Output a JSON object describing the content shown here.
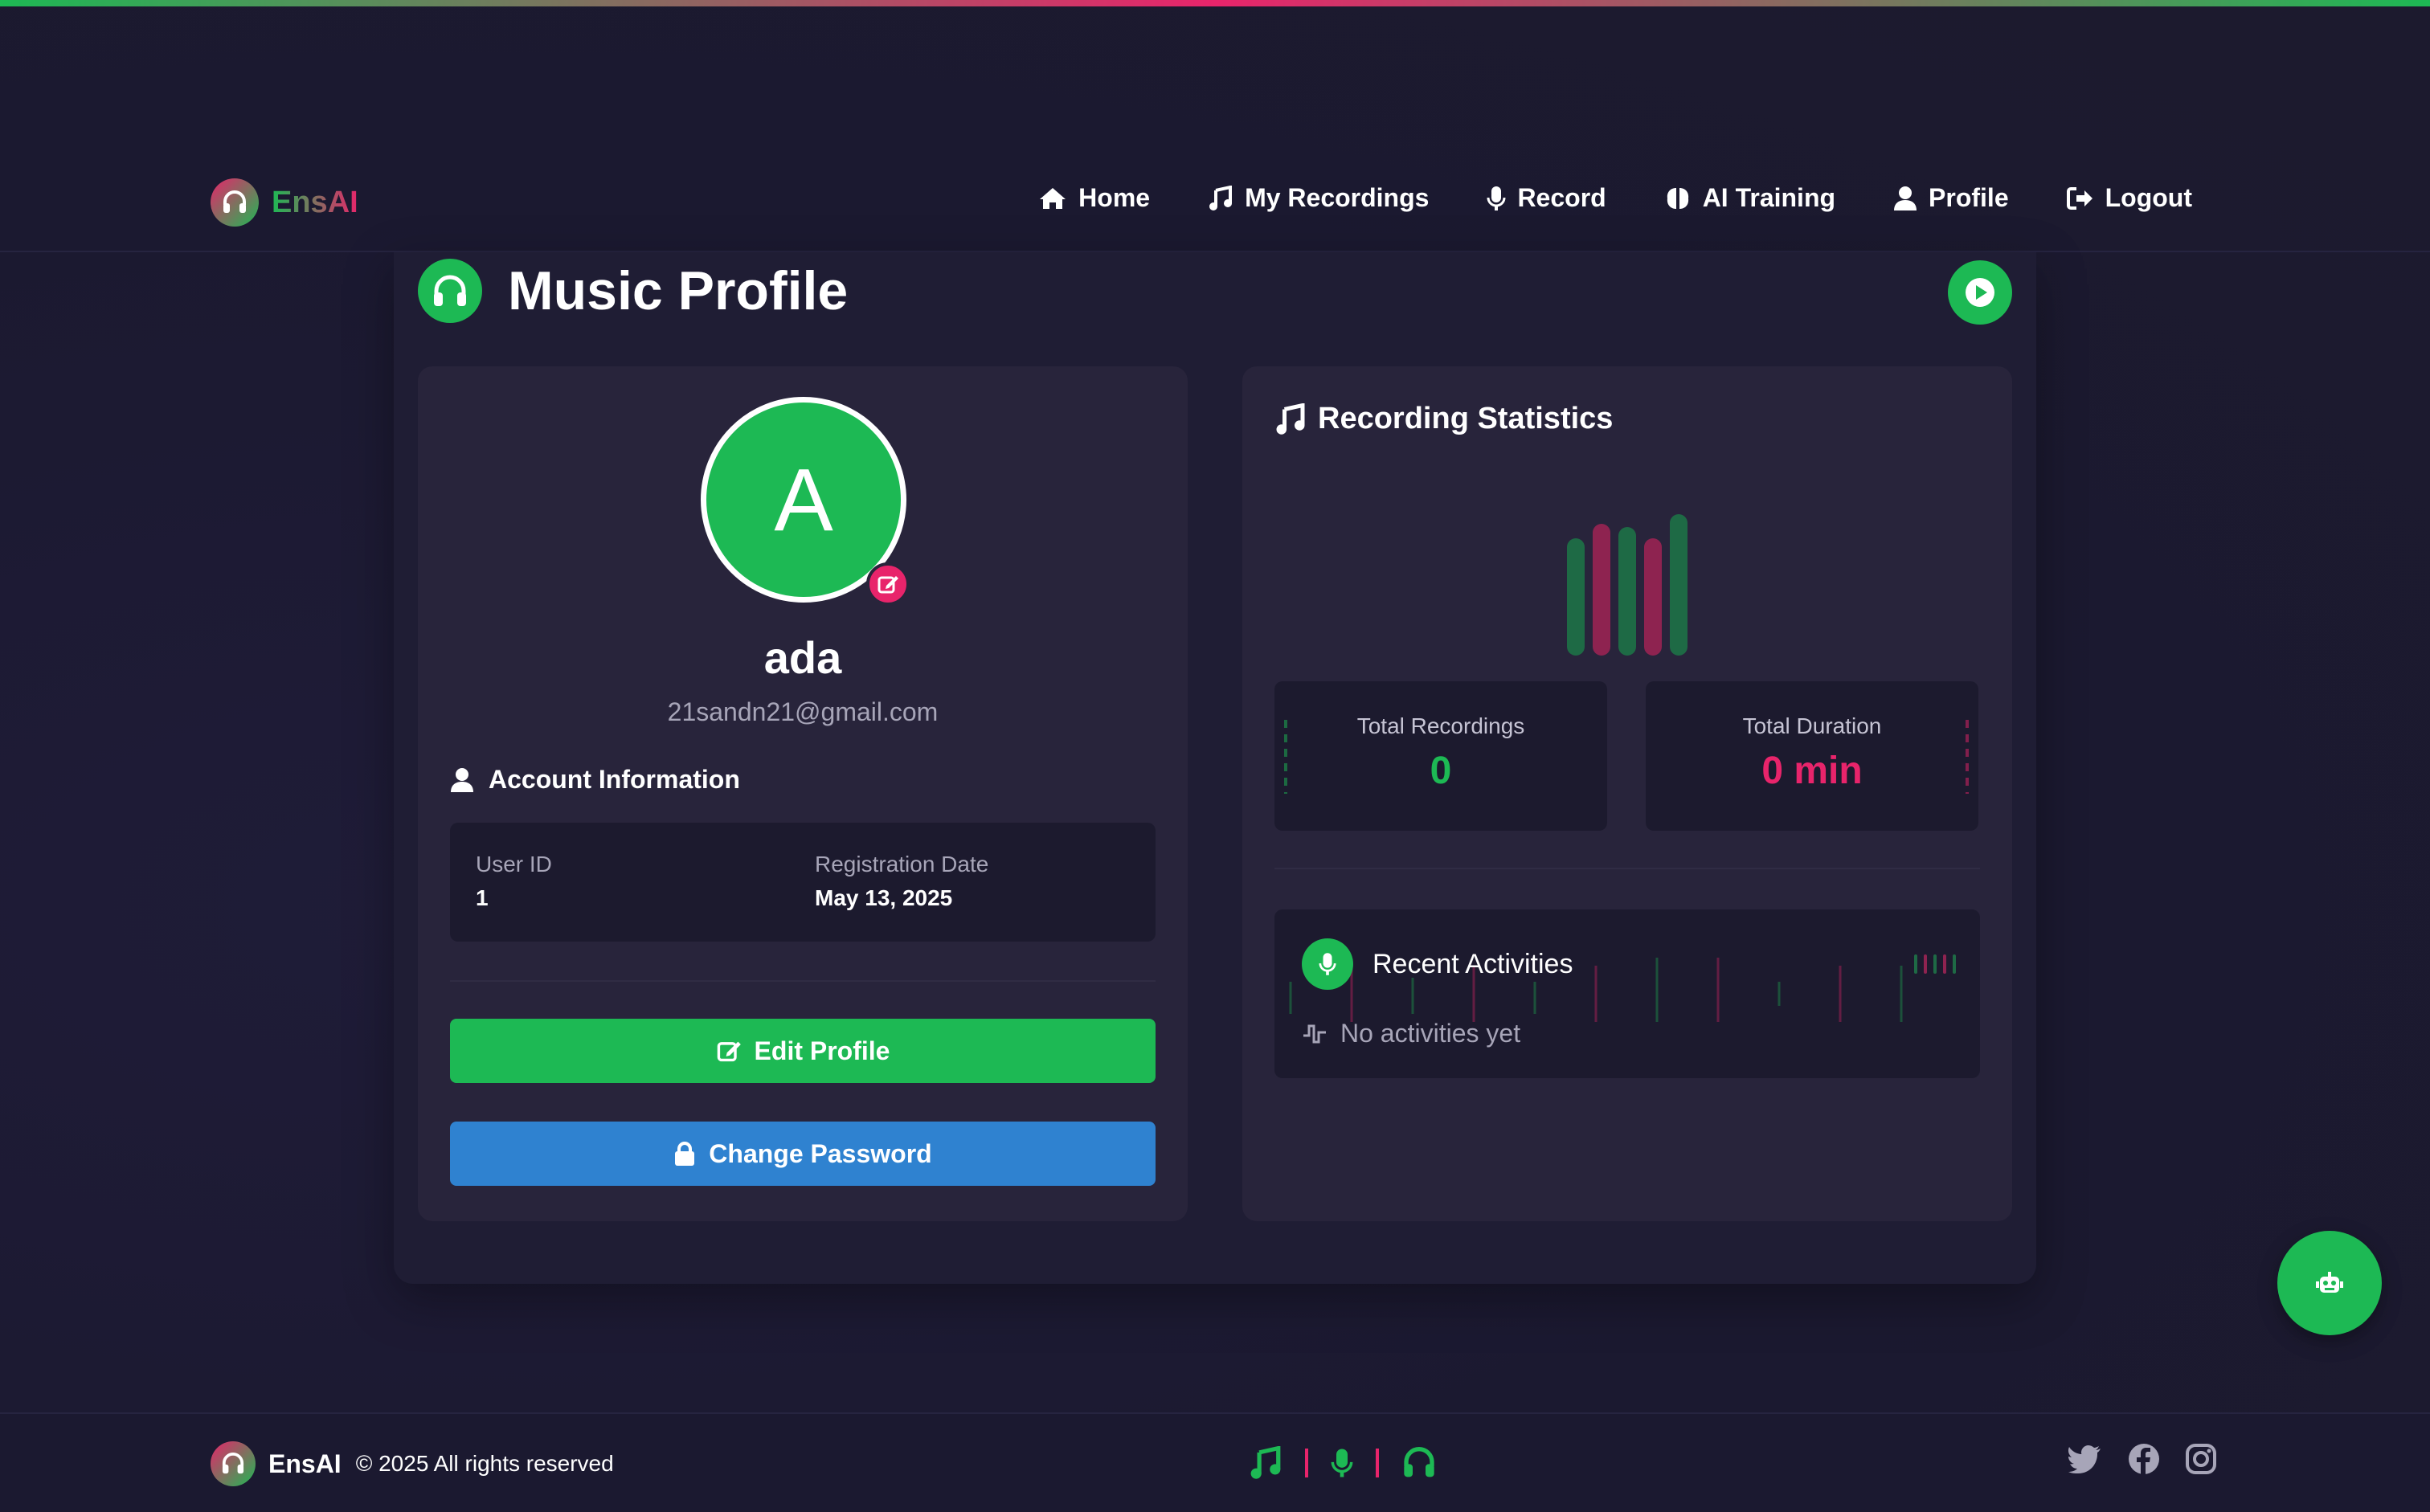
{
  "brand": {
    "name": "EnsAI"
  },
  "nav": {
    "items": [
      {
        "label": "Home",
        "icon": "home-icon"
      },
      {
        "label": "My Recordings",
        "icon": "music-note-icon"
      },
      {
        "label": "Record",
        "icon": "microphone-icon"
      },
      {
        "label": "AI Training",
        "icon": "brain-icon"
      },
      {
        "label": "Profile",
        "icon": "user-icon"
      },
      {
        "label": "Logout",
        "icon": "logout-icon"
      }
    ]
  },
  "page": {
    "title": "Music Profile"
  },
  "profile": {
    "avatar_letter": "A",
    "username": "ada",
    "email": "21sandn21@gmail.com",
    "account_section_title": "Account Information",
    "user_id_label": "User ID",
    "user_id": "1",
    "registration_label": "Registration Date",
    "registration_date": "May 13, 2025",
    "edit_button": "Edit Profile",
    "password_button": "Change Password"
  },
  "stats": {
    "title": "Recording Statistics",
    "total_recordings_label": "Total Recordings",
    "total_recordings": "0",
    "total_duration_label": "Total Duration",
    "total_duration": "0 min"
  },
  "activities": {
    "title": "Recent Activities",
    "empty": "No activities yet"
  },
  "footer": {
    "name": "EnsAI",
    "copyright": "© 2025 All rights reserved",
    "socials": [
      "twitter-icon",
      "facebook-icon",
      "instagram-icon"
    ]
  },
  "colors": {
    "accent_green": "#1db954",
    "accent_pink": "#e8246b",
    "accent_blue": "#2f82d0",
    "background": "#1b1930",
    "panel": "#28243b"
  }
}
